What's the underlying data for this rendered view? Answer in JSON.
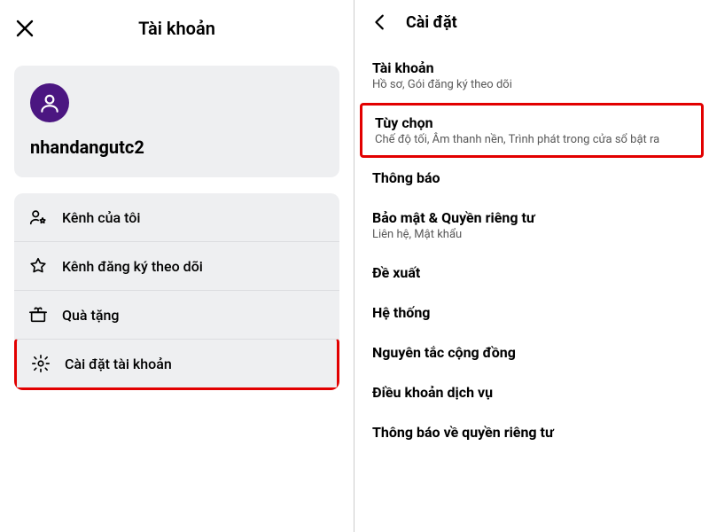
{
  "left": {
    "title": "Tài khoản",
    "profile": {
      "username": "nhandangutc2"
    },
    "menu": [
      {
        "icon": "user-star-icon",
        "label": "Kênh của tôi"
      },
      {
        "icon": "star-icon",
        "label": "Kênh đăng ký theo dõi"
      },
      {
        "icon": "gift-icon",
        "label": "Quà tặng"
      },
      {
        "icon": "gear-icon",
        "label": "Cài đặt tài khoản",
        "highlight": true
      }
    ]
  },
  "right": {
    "title": "Cài đặt",
    "items": [
      {
        "title": "Tài khoản",
        "sub": "Hồ sơ, Gói đăng ký theo dõi"
      },
      {
        "title": "Tùy chọn",
        "sub": "Chế độ tối, Âm thanh nền, Trình phát trong cửa sổ bật ra",
        "highlight": true
      },
      {
        "title": "Thông báo"
      },
      {
        "title": "Bảo mật & Quyền riêng tư",
        "sub": "Liên hệ, Mật khẩu"
      },
      {
        "title": "Đề xuất"
      },
      {
        "title": "Hệ thống"
      },
      {
        "title": "Nguyên tắc cộng đồng"
      },
      {
        "title": "Điều khoản dịch vụ"
      },
      {
        "title": "Thông báo về quyền riêng tư"
      }
    ]
  }
}
